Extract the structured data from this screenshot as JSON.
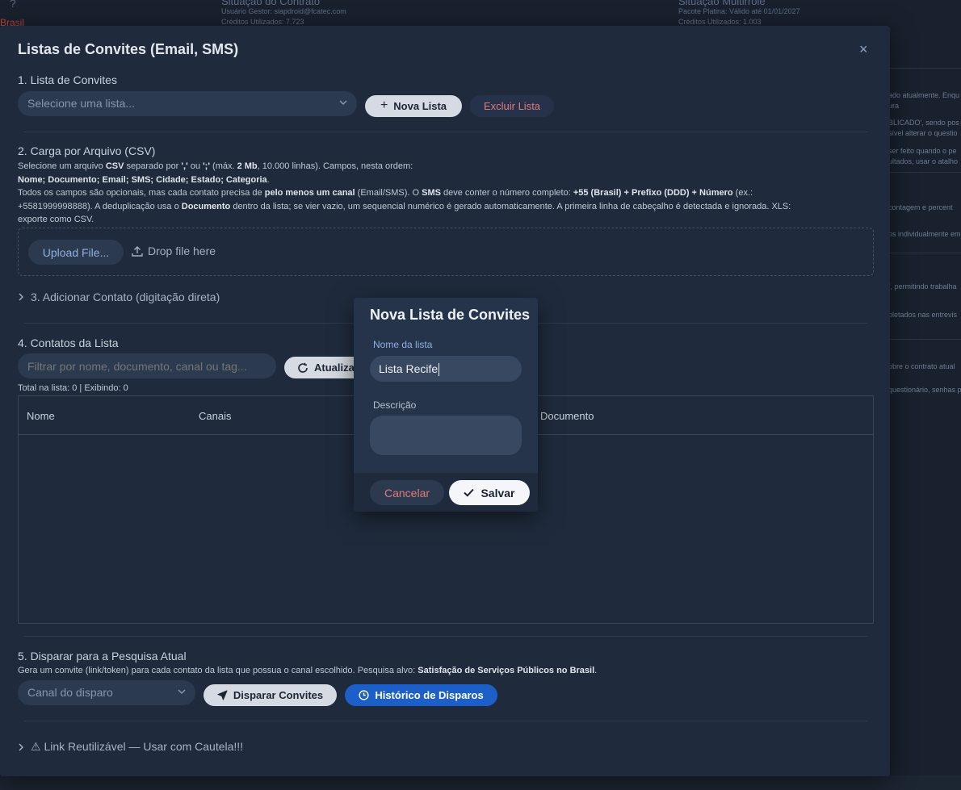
{
  "background": {
    "question_mark": "?",
    "country": "Brasil",
    "contract": {
      "title": "Situação do Contrato",
      "manager": "Usuário Gestor: siapdroid@fcatec.com",
      "credits": "Créditos Utilizados: 7.723"
    },
    "multirole": {
      "title": "Situação Multirrole",
      "plan": "Pacote Platina: Válido até 01/01/2027",
      "credits": "Créditos Utilizados: 1.003"
    },
    "side_texts": [
      "ado atualmente. Enqu",
      "ura",
      "BLICADO', sendo pos",
      "sível alterar o questio",
      "ser feito quando o pe",
      "ultados, usar o atalho",
      "contagem e percent",
      "os individualmente em",
      "/, permitindo trabalha",
      "oletados nas entrevis",
      "obre o contrato atual",
      "questionário, senhas p"
    ]
  },
  "modal": {
    "title": "Listas de Convites (Email, SMS)",
    "close": "×",
    "section1": {
      "title": "1. Lista de Convites",
      "select_placeholder": "Selecione uma lista...",
      "new_list": "Nova Lista",
      "delete_list": "Excluir Lista"
    },
    "section2": {
      "title": "2. Carga por Arquivo (CSV)",
      "line1_a": "Selecione um arquivo ",
      "line1_b": "CSV",
      "line1_c": " separado por ",
      "line1_d": "','",
      "line1_e": " ou ",
      "line1_f": "';'",
      "line1_g": " (máx. ",
      "line1_h": "2 Mb",
      "line1_i": ", 10.000 linhas). Campos, nesta ordem:",
      "line2": "Nome; Documento; Email; SMS; Cidade; Estado; Categoria",
      "line2_end": ".",
      "line3_a": "Todos os campos são opcionais, mas cada contato precisa de ",
      "line3_b": "pelo menos um canal",
      "line3_c": " (Email/SMS). O ",
      "line3_d": "SMS",
      "line3_e": " deve conter o número completo: ",
      "line3_f": "+55 (Brasil) + Prefixo (DDD) + Número",
      "line3_g": " (ex.:",
      "line4_a": "+5581999998888). A deduplicação usa o ",
      "line4_b": "Documento",
      "line4_c": " dentro da lista; se vier vazio, um sequencial numérico é gerado automaticamente. A primeira linha de cabeçalho é detectada e ignorada. XLS:",
      "line5": "exporte como CSV.",
      "upload": "Upload File...",
      "drop": "Drop file here"
    },
    "section3": {
      "title": "3. Adicionar Contato (digitação direta)"
    },
    "section4": {
      "title": "4. Contatos da Lista",
      "filter_placeholder": "Filtrar por nome, documento, canal ou tag...",
      "refresh": "Atualizar",
      "totals": "Total na lista: 0 | Exibindo: 0",
      "columns": [
        "Nome",
        "Canais",
        "",
        "Documento"
      ]
    },
    "section5": {
      "title": "5. Disparar para a Pesquisa Atual",
      "desc_a": "Gera um convite (link/token) para cada contato da lista que possua o canal escolhido. Pesquisa alvo: ",
      "desc_b": "Satisfação de Serviços Públicos no Brasil",
      "desc_c": ".",
      "channel_placeholder": "Canal do disparo",
      "send": "Disparar Convites",
      "history": "Histórico de Disparos"
    },
    "section6": {
      "title": "⚠ Link Reutilizável — Usar com Cautela!!!"
    }
  },
  "dialog": {
    "title": "Nova Lista de Convites",
    "name_label": "Nome da lista",
    "name_value": "Lista Recife",
    "description_label": "Descrição",
    "description_value": "",
    "cancel": "Cancelar",
    "save": "Salvar"
  },
  "colors": {
    "modal_bg": "#1f2b3d",
    "dialog_bg": "#25344a",
    "accent_blue": "#1d5fc9",
    "danger": "#e07a7a",
    "label_blue": "#8fb0e2"
  }
}
